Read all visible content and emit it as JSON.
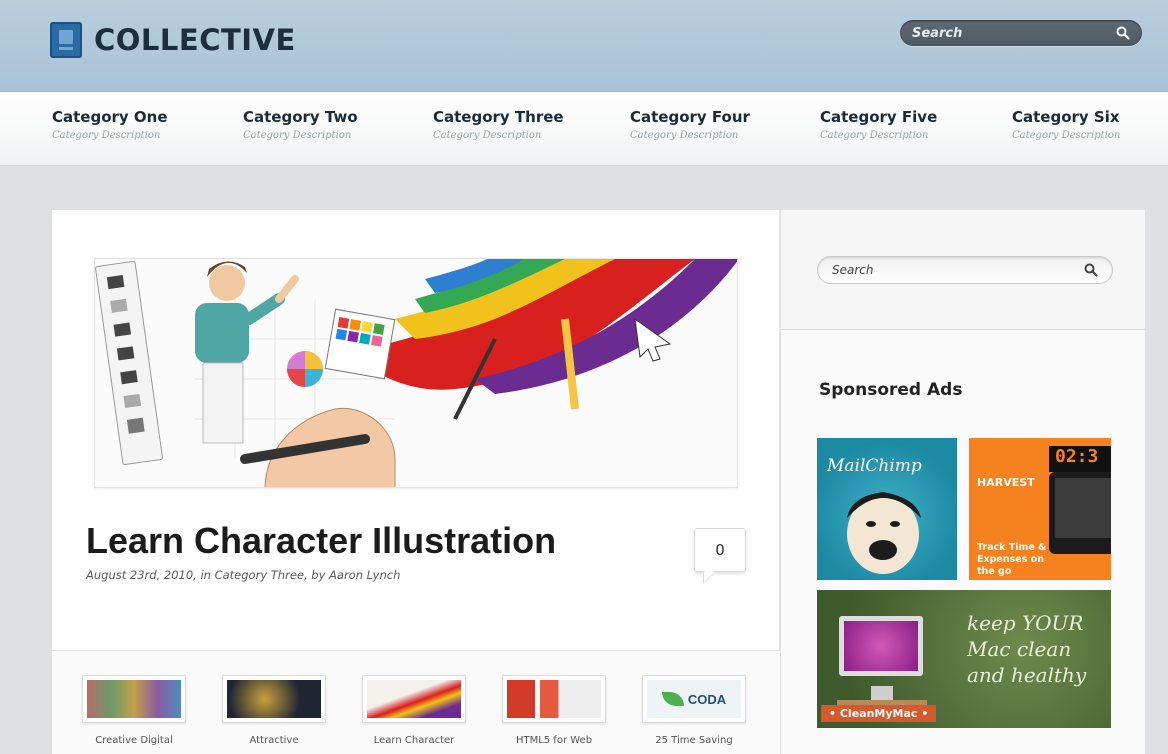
{
  "header": {
    "logo_text": "COLLECTIVE",
    "search_placeholder": "Search"
  },
  "nav": {
    "items": [
      {
        "title": "Category One",
        "desc": "Category Description"
      },
      {
        "title": "Category Two",
        "desc": "Category Description"
      },
      {
        "title": "Category Three",
        "desc": "Category Description"
      },
      {
        "title": "Category Four",
        "desc": "Category Description"
      },
      {
        "title": "Category Five",
        "desc": "Category Description"
      },
      {
        "title": "Category Six",
        "desc": "Category Description"
      }
    ]
  },
  "post": {
    "title": "Learn Character Illustration",
    "meta": "August 23rd, 2010, in Category Three, by Aaron Lynch",
    "comment_count": "0"
  },
  "related": {
    "items": [
      {
        "label": "Creative Digital",
        "color": "#b36b6b"
      },
      {
        "label": "Attractive",
        "color": "#2b3140"
      },
      {
        "label": "Learn Character",
        "color": "#e8e3de"
      },
      {
        "label": "HTML5 for Web",
        "color": "#d23a2a"
      },
      {
        "label": "25 Time Saving",
        "color": "#e9f0f5"
      }
    ],
    "coda_text": "CODA"
  },
  "sidebar": {
    "search_placeholder": "Search",
    "heading": "Sponsored Ads",
    "ads": {
      "mailchimp": "MailChimp",
      "harvest_title": "HARVEST",
      "harvest_clock": "02:3",
      "harvest_sub": "Track Time & Expenses on the go",
      "cleanmymac_text": "keep YOUR Mac clean and healthy",
      "cleanmymac_label": "• CleanMyMac •"
    }
  },
  "colors": {
    "header_bg": "#b1c9da",
    "logo_blue": "#2b6aa3",
    "harvest_orange": "#f5821f"
  }
}
